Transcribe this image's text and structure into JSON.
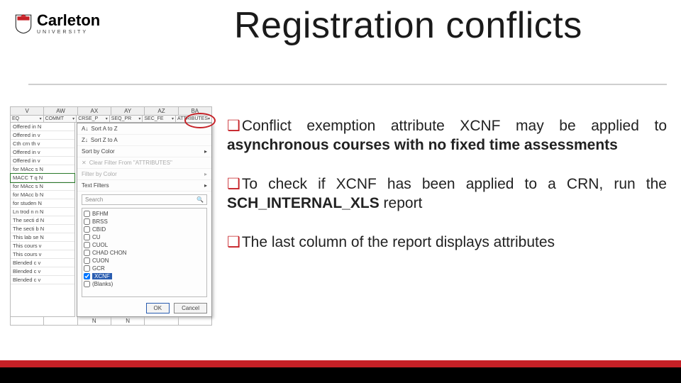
{
  "logo": {
    "word": "Carleton",
    "sub": "UNIVERSITY"
  },
  "title": "Registration conflicts",
  "bullets": [
    {
      "pre": "Conflict exemption attribute XCNF may be applied to ",
      "bold": "asynchronous courses with no fixed time assessments",
      "post": ""
    },
    {
      "pre": "To check if XCNF has been applied to a CRN, run the ",
      "bold": "SCH_INTERNAL_XLS",
      "post": " report"
    },
    {
      "pre": "The last column of the report displays attributes",
      "bold": "",
      "post": ""
    }
  ],
  "excel": {
    "colLetters": [
      "V",
      "AW",
      "AX",
      "AY",
      "AZ",
      "BA"
    ],
    "headers": [
      "EQ",
      "COMMT",
      "CRSE_P",
      "SEQ_PR",
      "SEC_FE",
      "ATTRIBUTES"
    ],
    "leftRows": [
      "Offered in N",
      "Offered in v",
      "Cth crn th v",
      "Offered in v",
      "Offered in v",
      "for MAcc s N",
      "MACC T q N",
      "for MAcc s N",
      "for MAcc b N",
      "for studen N",
      "Ln trod n n N",
      "The secti d N",
      "The secti b N",
      "This lab se N",
      "This cours v",
      "This cours v",
      "Blended c v",
      "Blended c v",
      "Blended c v"
    ],
    "menu": {
      "sortAsc": "Sort A to Z",
      "sortDesc": "Sort Z to A",
      "sortColor": "Sort by Color",
      "clear": "Clear Filter From \"ATTRIBUTES\"",
      "filterColor": "Filter by Color",
      "textFilters": "Text Filters",
      "searchPlaceholder": "Search",
      "checks": [
        {
          "label": "BFHM",
          "checked": false
        },
        {
          "label": "BRSS",
          "checked": false
        },
        {
          "label": "CBID",
          "checked": false
        },
        {
          "label": "CU",
          "checked": false
        },
        {
          "label": "CUOL",
          "checked": false
        },
        {
          "label": "CHAD CHON",
          "checked": false
        },
        {
          "label": "CUON",
          "checked": false
        },
        {
          "label": "GCR",
          "checked": false
        },
        {
          "label": "XCNF",
          "checked": true,
          "highlight": true
        },
        {
          "label": "(Blanks)",
          "checked": false
        }
      ],
      "ok": "OK",
      "cancel": "Cancel"
    },
    "bottomRow": [
      "",
      "",
      "N",
      "N",
      "",
      ""
    ]
  }
}
